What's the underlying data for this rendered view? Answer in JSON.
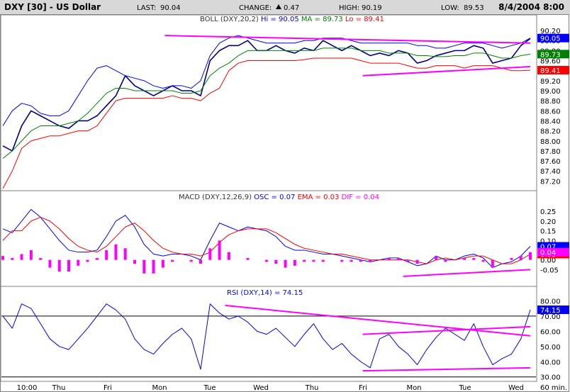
{
  "header": {
    "title": "DXY [30] - US Dollar",
    "last_label": "LAST:",
    "last_value": "90.04",
    "change_label": "CHANGE:",
    "change_value": "0.47",
    "high_label": "HIGH:",
    "high_value": "90.19",
    "low_label": "LOW:",
    "low_value": "89.53",
    "datetime": "8/4/2004 8:00"
  },
  "colors": {
    "background": "#ffffff",
    "header_bg": "#d8d8d8",
    "price": "#000080",
    "boll_upper": "#0000ff",
    "boll_ma": "#008000",
    "boll_lower": "#ff0000",
    "trendline": "#ff00ff",
    "macd": "#0000ff",
    "ema": "#ff0000",
    "dif": "#ff00ff",
    "rsi": "#0000ff"
  },
  "x_axis": {
    "labels": [
      "10:00",
      "Thu",
      "Fri",
      "Mon",
      "Tue",
      "Wed",
      "Thu",
      "Fri",
      "Mon",
      "Tue",
      "Wed"
    ],
    "interval_label": "60 min."
  },
  "chart_data": [
    {
      "type": "line",
      "panel": "price",
      "title_prefix": "BOLL (DXY,20,2)",
      "indicators": [
        {
          "label": "Hi",
          "value": "90.05"
        },
        {
          "label": "MA",
          "value": "89.73"
        },
        {
          "label": "Lo",
          "value": "89.41"
        }
      ],
      "ylim": [
        87.05,
        90.3
      ],
      "yticks": [
        90.2,
        90.0,
        89.8,
        89.6,
        89.4,
        89.2,
        89.0,
        88.8,
        88.6,
        88.4,
        88.2,
        88.0,
        87.8,
        87.6,
        87.4,
        87.2
      ],
      "ytick_labels": [
        "90.20",
        "90.00",
        "89.80",
        "89.60",
        "89.40",
        "89.20",
        "89.00",
        "88.80",
        "88.60",
        "88.40",
        "88.20",
        "88.00",
        "87.80",
        "87.60",
        "87.40",
        "87.20"
      ],
      "tags": [
        {
          "text": "90.05",
          "value": 90.05,
          "color": "#0000ff"
        },
        {
          "text": "89.73",
          "value": 89.73,
          "color": "#008000"
        },
        {
          "text": "89.41",
          "value": 89.41,
          "color": "#ff0000"
        }
      ],
      "grid": false,
      "series": [
        {
          "name": "Price",
          "color": "#000080",
          "values": [
            87.9,
            87.8,
            88.3,
            88.6,
            88.5,
            88.4,
            88.3,
            88.25,
            88.4,
            88.4,
            88.5,
            88.7,
            88.9,
            89.3,
            89.1,
            89.0,
            88.9,
            89.0,
            89.1,
            89.0,
            89.0,
            88.9,
            89.6,
            89.8,
            89.9,
            89.9,
            90.0,
            89.8,
            89.8,
            89.9,
            89.8,
            89.75,
            89.85,
            89.8,
            90.0,
            89.9,
            89.8,
            89.9,
            89.8,
            89.7,
            89.75,
            89.7,
            89.8,
            89.75,
            89.55,
            89.6,
            89.7,
            89.75,
            89.8,
            89.8,
            89.9,
            89.85,
            89.55,
            89.6,
            89.65,
            89.9,
            90.04
          ]
        },
        {
          "name": "Hi",
          "color": "#0000ff",
          "values": [
            88.3,
            88.6,
            88.75,
            88.7,
            88.55,
            88.5,
            88.5,
            88.6,
            88.9,
            89.2,
            89.45,
            89.5,
            89.4,
            89.3,
            89.25,
            89.2,
            89.1,
            89.05,
            89.1,
            89.1,
            89.05,
            89.2,
            89.7,
            89.95,
            90.05,
            90.1,
            90.05,
            90.0,
            89.95,
            89.95,
            89.95,
            89.95,
            90.0,
            90.0,
            90.05,
            90.05,
            90.05,
            90.0,
            89.95,
            89.95,
            89.95,
            89.95,
            89.95,
            89.95,
            89.9,
            89.9,
            89.85,
            89.85,
            89.9,
            89.95,
            89.95,
            89.95,
            89.9,
            89.85,
            89.9,
            89.95,
            90.05
          ]
        },
        {
          "name": "MA",
          "color": "#008000",
          "values": [
            87.65,
            87.8,
            88.0,
            88.2,
            88.3,
            88.3,
            88.3,
            88.35,
            88.4,
            88.55,
            88.75,
            88.95,
            89.05,
            89.05,
            89.0,
            89.0,
            89.0,
            89.0,
            89.0,
            88.95,
            88.95,
            89.0,
            89.3,
            89.45,
            89.55,
            89.7,
            89.8,
            89.8,
            89.8,
            89.8,
            89.8,
            89.8,
            89.8,
            89.8,
            89.85,
            89.85,
            89.85,
            89.85,
            89.8,
            89.8,
            89.8,
            89.75,
            89.75,
            89.75,
            89.7,
            89.7,
            89.68,
            89.68,
            89.7,
            89.7,
            89.75,
            89.75,
            89.7,
            89.65,
            89.65,
            89.7,
            89.73
          ]
        },
        {
          "name": "Lo",
          "color": "#ff0000",
          "values": [
            87.05,
            87.4,
            87.85,
            88.0,
            88.05,
            88.1,
            88.1,
            88.15,
            88.2,
            88.2,
            88.3,
            88.55,
            88.8,
            88.85,
            88.85,
            88.85,
            88.85,
            88.85,
            88.9,
            88.85,
            88.85,
            88.8,
            88.95,
            89.05,
            89.4,
            89.55,
            89.6,
            89.6,
            89.6,
            89.6,
            89.6,
            89.6,
            89.62,
            89.65,
            89.65,
            89.65,
            89.65,
            89.65,
            89.6,
            89.55,
            89.55,
            89.55,
            89.55,
            89.5,
            89.45,
            89.45,
            89.5,
            89.5,
            89.5,
            89.45,
            89.5,
            89.5,
            89.5,
            89.45,
            89.4,
            89.4,
            89.41
          ]
        },
        {
          "name": "Trendline",
          "color": "#ff00ff",
          "x": [
            17.2,
            56
          ],
          "values": [
            90.1,
            89.95
          ]
        },
        {
          "name": "Trendline",
          "color": "#ff00ff",
          "x": [
            38.2,
            56
          ],
          "values": [
            89.3,
            89.48
          ]
        }
      ]
    },
    {
      "type": "line",
      "panel": "macd",
      "title_prefix": "MACD (DXY,12,26,9)",
      "indicators": [
        {
          "label": "OSC",
          "value": "0.07"
        },
        {
          "label": "EMA",
          "value": "0.03"
        },
        {
          "label": "DIF",
          "value": "0.04"
        }
      ],
      "ylim": [
        -0.1,
        0.28
      ],
      "yticks": [
        0.25,
        0.2,
        0.15,
        0.1,
        0.05,
        0.0,
        -0.05
      ],
      "ytick_labels": [
        "0.25",
        "0.20",
        "0.15",
        "0.10",
        "0.05",
        "0.00",
        "-0.05"
      ],
      "tags": [
        {
          "text": "0.07",
          "value": 0.07,
          "color": "#0000ff"
        },
        {
          "text": "0.03",
          "value": 0.03,
          "color": "#ff0000"
        },
        {
          "text": "0.04",
          "value": 0.04,
          "color": "#ff00ff"
        }
      ],
      "grid": false,
      "series": [
        {
          "name": "OSC",
          "color": "#0000ff",
          "values": [
            0.16,
            0.14,
            0.2,
            0.26,
            0.22,
            0.16,
            0.1,
            0.05,
            0.04,
            0.04,
            0.05,
            0.12,
            0.2,
            0.23,
            0.17,
            0.08,
            0.03,
            0.02,
            0.03,
            0.03,
            0.02,
            0.0,
            0.1,
            0.19,
            0.17,
            0.15,
            0.17,
            0.16,
            0.15,
            0.12,
            0.07,
            0.05,
            0.05,
            0.04,
            0.03,
            0.03,
            0.02,
            0.01,
            0.0,
            -0.01,
            0.0,
            0.01,
            0.01,
            -0.01,
            -0.03,
            -0.02,
            0.02,
            0.0,
            0.0,
            0.02,
            0.03,
            0.01,
            -0.04,
            -0.02,
            -0.01,
            0.02,
            0.07
          ]
        },
        {
          "name": "EMA",
          "color": "#ff0000",
          "values": [
            0.1,
            0.15,
            0.15,
            0.2,
            0.22,
            0.2,
            0.16,
            0.11,
            0.07,
            0.05,
            0.04,
            0.07,
            0.12,
            0.17,
            0.19,
            0.15,
            0.1,
            0.06,
            0.04,
            0.03,
            0.03,
            0.02,
            0.04,
            0.09,
            0.13,
            0.15,
            0.16,
            0.16,
            0.16,
            0.14,
            0.11,
            0.08,
            0.06,
            0.05,
            0.04,
            0.03,
            0.03,
            0.02,
            0.01,
            0.0,
            0.0,
            0.0,
            0.0,
            0.0,
            -0.01,
            -0.02,
            0.0,
            0.01,
            0.0,
            0.01,
            0.02,
            0.02,
            0.0,
            -0.02,
            -0.02,
            0.0,
            0.03
          ]
        },
        {
          "name": "DIF",
          "color": "#ff00ff",
          "kind": "histogram",
          "values": [
            0.02,
            0.01,
            0.03,
            0.05,
            0.01,
            -0.04,
            -0.06,
            -0.06,
            -0.03,
            -0.01,
            0.01,
            0.05,
            0.08,
            0.06,
            -0.02,
            -0.07,
            -0.07,
            -0.04,
            -0.01,
            0.0,
            -0.01,
            -0.02,
            0.06,
            0.1,
            0.04,
            0.0,
            0.01,
            0.0,
            -0.01,
            -0.02,
            -0.04,
            -0.03,
            -0.01,
            -0.01,
            -0.01,
            0.0,
            -0.01,
            -0.01,
            -0.01,
            -0.01,
            0.0,
            0.01,
            0.01,
            -0.01,
            -0.02,
            0.0,
            0.02,
            -0.01,
            0.0,
            0.01,
            0.01,
            -0.01,
            -0.04,
            0.0,
            0.01,
            0.02,
            0.04
          ]
        },
        {
          "name": "Trendline",
          "color": "#ff00ff",
          "x": [
            42.5,
            56
          ],
          "values": [
            -0.085,
            -0.05
          ]
        }
      ]
    },
    {
      "type": "line",
      "panel": "rsi",
      "title_prefix": "RSI (DXY,14)",
      "indicators": [
        {
          "label": "",
          "value": "74.15"
        }
      ],
      "ylim": [
        28,
        83
      ],
      "yticks": [
        80,
        70,
        60,
        50,
        40,
        30
      ],
      "ytick_labels": [
        "80.00",
        "70.00",
        "60.00",
        "50.00",
        "40.00",
        "30.00"
      ],
      "reference_lines": [
        70,
        30
      ],
      "tags": [
        {
          "text": "74.15",
          "value": 74.15,
          "color": "#0000ff"
        }
      ],
      "grid": false,
      "series": [
        {
          "name": "RSI",
          "color": "#0000ff",
          "values": [
            70,
            62,
            78,
            75,
            65,
            55,
            50,
            48,
            55,
            62,
            70,
            78,
            74,
            68,
            55,
            48,
            45,
            52,
            58,
            62,
            55,
            35,
            78,
            72,
            68,
            70,
            66,
            60,
            58,
            62,
            56,
            50,
            58,
            65,
            55,
            48,
            52,
            45,
            40,
            36,
            55,
            58,
            50,
            45,
            38,
            48,
            56,
            62,
            58,
            54,
            65,
            50,
            38,
            42,
            45,
            55,
            74.15
          ]
        },
        {
          "name": "Trendline",
          "color": "#ff00ff",
          "x": [
            23.6,
            56
          ],
          "values": [
            77,
            57
          ]
        },
        {
          "name": "Trendline",
          "color": "#ff00ff",
          "x": [
            38.2,
            56
          ],
          "values": [
            58,
            63
          ]
        },
        {
          "name": "Trendline",
          "color": "#ff00ff",
          "x": [
            38.2,
            56
          ],
          "values": [
            34,
            36
          ]
        }
      ]
    }
  ]
}
